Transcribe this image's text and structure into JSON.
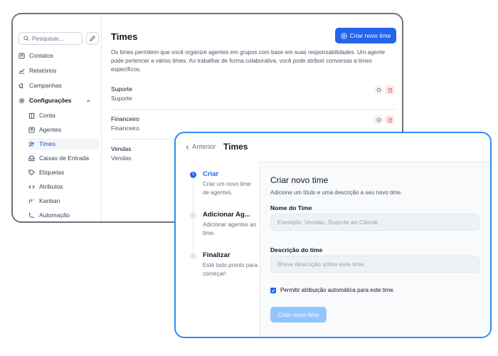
{
  "colors": {
    "accent": "#2563eb",
    "front_border": "#2b8ef0",
    "danger": "#ef4444"
  },
  "sidebar": {
    "search_placeholder": "Pesquisar...",
    "items": [
      {
        "label": "Contatos",
        "icon": "contacts-icon"
      },
      {
        "label": "Relatórios",
        "icon": "reports-icon"
      },
      {
        "label": "Campanhas",
        "icon": "megaphone-icon"
      },
      {
        "label": "Configurações",
        "icon": "gear-icon"
      }
    ],
    "sub_items": [
      {
        "label": "Conta",
        "icon": "building-icon"
      },
      {
        "label": "Agentes",
        "icon": "agent-icon"
      },
      {
        "label": "Times",
        "icon": "users-icon"
      },
      {
        "label": "Caixas de Entrada",
        "icon": "inbox-icon"
      },
      {
        "label": "Etiquetas",
        "icon": "tag-icon"
      },
      {
        "label": "Atributos",
        "icon": "code-icon"
      },
      {
        "label": "Kanban",
        "icon": "kanban-icon"
      },
      {
        "label": "Automação",
        "icon": "automation-icon"
      }
    ]
  },
  "back": {
    "title": "Times",
    "create_label": "Criar novo time",
    "description": "Os times permitem que você organize agentes em grupos com base em suas responsabilidades. Um agente pode pertencer a vários times. Ao trabalhar de forma colaborativa, você pode atribuir conversas a times específicos.",
    "teams": [
      {
        "name": "Suporte",
        "desc": "Suporte"
      },
      {
        "name": "Financeiro",
        "desc": "Financeiro"
      },
      {
        "name": "Vendas",
        "desc": "Vendas"
      }
    ]
  },
  "front": {
    "back_label": "Anterior",
    "title": "Times",
    "steps": [
      {
        "num": "1",
        "title": "Criar",
        "desc": "Criar um novo time de agentes."
      },
      {
        "num": "",
        "title": "Adicionar Ag...",
        "desc": "Adicionar agentes ao time."
      },
      {
        "num": "",
        "title": "Finalizar",
        "desc": "Está tudo pronto para começar!"
      }
    ],
    "form": {
      "title": "Criar novo time",
      "subtitle": "Adicione um título e uma descrição a seu novo time.",
      "name_label": "Nome do Time",
      "name_placeholder": "Exemplo: Vendas, Suporte ao Cliente",
      "desc_label": "Descrição do time",
      "desc_placeholder": "Breve descrição sobre este time.",
      "checkbox_label": "Permitir atribuição automática para este time.",
      "submit_label": "Criar novo time"
    }
  }
}
